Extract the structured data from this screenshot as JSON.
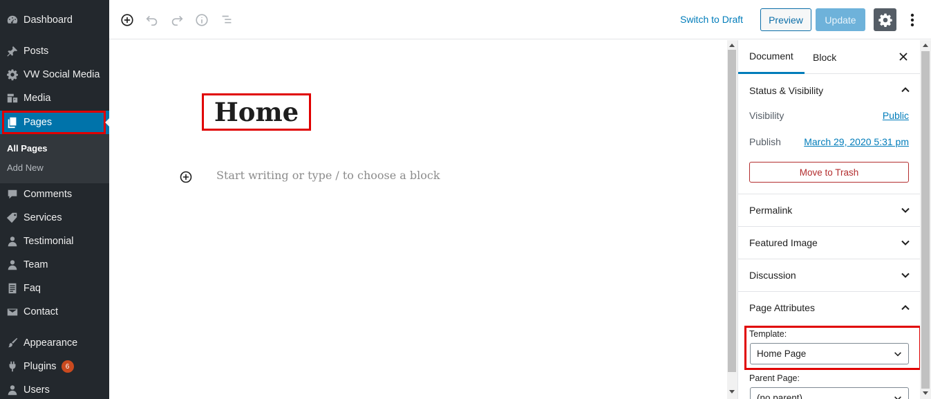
{
  "sidebar": {
    "items": [
      {
        "label": "Dashboard",
        "icon": "dashboard-icon"
      },
      {
        "label": "Posts",
        "icon": "pin-icon"
      },
      {
        "label": "VW Social Media",
        "icon": "gear-icon"
      },
      {
        "label": "Media",
        "icon": "media-icon"
      },
      {
        "label": "Pages",
        "icon": "pages-icon"
      },
      {
        "label": "Comments",
        "icon": "comment-icon"
      },
      {
        "label": "Services",
        "icon": "tag-icon"
      },
      {
        "label": "Testimonial",
        "icon": "person-icon"
      },
      {
        "label": "Team",
        "icon": "person-icon"
      },
      {
        "label": "Faq",
        "icon": "document-icon"
      },
      {
        "label": "Contact",
        "icon": "mail-icon"
      },
      {
        "label": "Appearance",
        "icon": "paintbrush-icon"
      },
      {
        "label": "Plugins",
        "icon": "plug-icon",
        "badge": "6"
      },
      {
        "label": "Users",
        "icon": "user-icon"
      }
    ],
    "submenu": [
      {
        "label": "All Pages"
      },
      {
        "label": "Add New"
      }
    ]
  },
  "toolbar": {
    "switch_draft": "Switch to Draft",
    "preview": "Preview",
    "update": "Update"
  },
  "editor": {
    "title": "Home",
    "placeholder": "Start writing or type / to choose a block"
  },
  "settings": {
    "tab_document": "Document",
    "tab_block": "Block",
    "status_visibility": "Status & Visibility",
    "visibility_label": "Visibility",
    "visibility_value": "Public",
    "publish_label": "Publish",
    "publish_value": "March 29, 2020 5:31 pm",
    "move_to_trash": "Move to Trash",
    "permalink": "Permalink",
    "featured_image": "Featured Image",
    "discussion": "Discussion",
    "page_attributes": "Page Attributes",
    "template_label": "Template:",
    "template_value": "Home Page",
    "parent_label": "Parent Page:",
    "parent_value": "(no parent)"
  },
  "colors": {
    "sidebar_bg": "#23282d",
    "active_bg": "#0073aa",
    "accent": "#007cba",
    "highlight": "#e00000",
    "danger": "#b32d2e"
  }
}
